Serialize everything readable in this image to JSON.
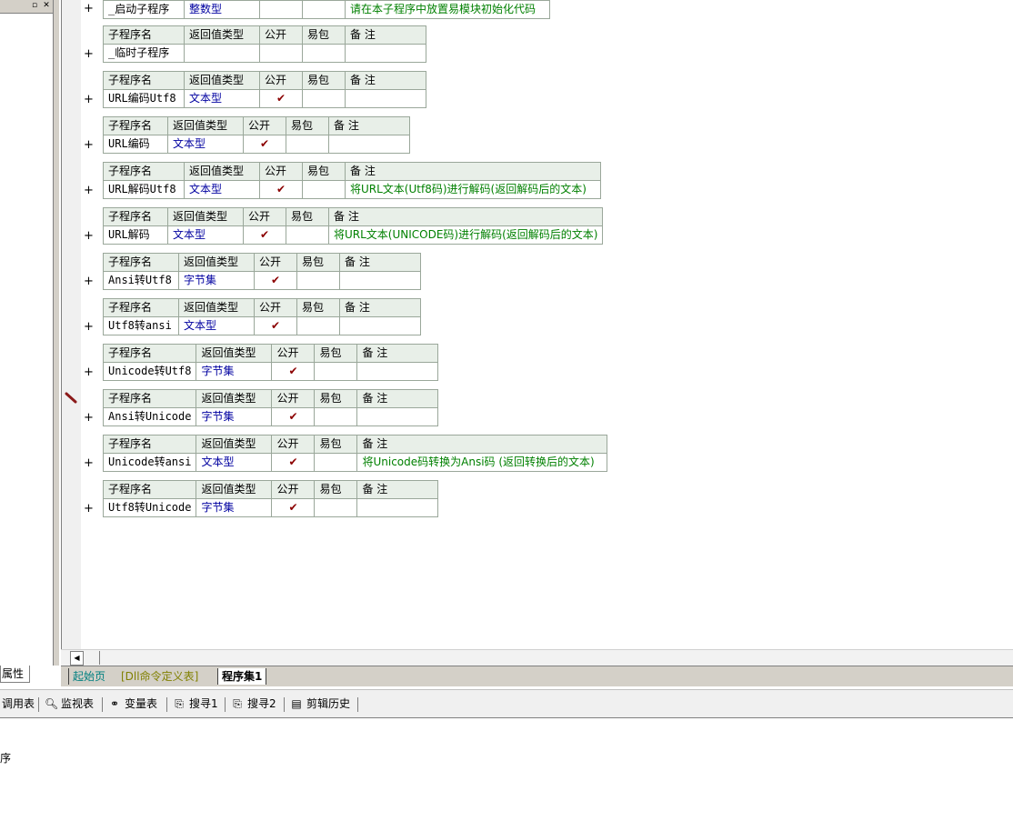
{
  "left_panel": {
    "attr_tab": "属性"
  },
  "table_headers": {
    "name": "子程序名",
    "return_type": "返回值类型",
    "public": "公开",
    "easy_pkg": "易包",
    "remark": "备 注"
  },
  "check_mark": "✔",
  "plus": "+",
  "subprograms": [
    {
      "name": "_启动子程序",
      "type": "整数型",
      "public": "",
      "remark": "请在本子程序中放置易模块初始化代码"
    },
    {
      "name": "_临时子程序",
      "type": "",
      "public": "",
      "remark": ""
    },
    {
      "name": "URL编码Utf8",
      "type": "文本型",
      "public": "✔",
      "remark": ""
    },
    {
      "name": "URL编码",
      "type": "文本型",
      "public": "✔",
      "remark": ""
    },
    {
      "name": "URL解码Utf8",
      "type": "文本型",
      "public": "✔",
      "remark": "将URL文本(Utf8码)进行解码(返回解码后的文本)"
    },
    {
      "name": "URL解码",
      "type": "文本型",
      "public": "✔",
      "remark": "将URL文本(UNICODE码)进行解码(返回解码后的文本)"
    },
    {
      "name": "Ansi转Utf8",
      "type": "字节集",
      "public": "✔",
      "remark": ""
    },
    {
      "name": "Utf8转ansi",
      "type": "文本型",
      "public": "✔",
      "remark": ""
    },
    {
      "name": "Unicode转Utf8",
      "type": "字节集",
      "public": "✔",
      "remark": ""
    },
    {
      "name": "Ansi转Unicode",
      "type": "字节集",
      "public": "✔",
      "remark": ""
    },
    {
      "name": "Unicode转ansi",
      "type": "文本型",
      "public": "✔",
      "remark": "将Unicode码转换为Ansi码 (返回转换后的文本)"
    },
    {
      "name": "Utf8转Unicode",
      "type": "字节集",
      "public": "✔",
      "remark": ""
    }
  ],
  "doc_tabs": {
    "start": "起始页",
    "dll": "[Dll命令定义表]",
    "program": "程序集1"
  },
  "bottom_tabs": [
    "调用表",
    "监视表",
    "变量表",
    "搜寻1",
    "搜寻2",
    "剪辑历史"
  ],
  "output_text": "序"
}
